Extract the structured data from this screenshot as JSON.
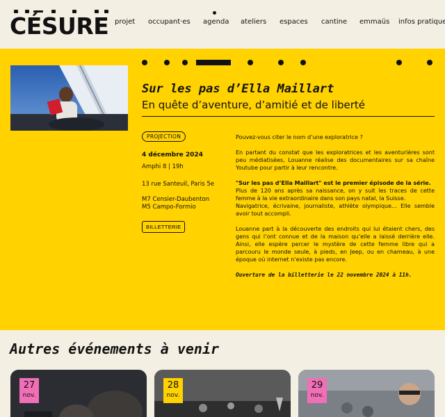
{
  "logo": {
    "text": "CÉSURE"
  },
  "nav": [
    {
      "id": "projet",
      "label": "projet"
    },
    {
      "id": "occupantes",
      "label": "occupant·es"
    },
    {
      "id": "agenda",
      "label": "agenda"
    },
    {
      "id": "ateliers",
      "label": "ateliers"
    },
    {
      "id": "espaces",
      "label": "espaces"
    },
    {
      "id": "cantine",
      "label": "cantine"
    },
    {
      "id": "emmaus",
      "label": "emmaüs"
    },
    {
      "id": "infos",
      "label": "infos pratique"
    }
  ],
  "event": {
    "title": "Sur les pas d’Ella Maillart",
    "subtitle": "En quête d’aventure, d’amitié et de liberté",
    "category": "PROJECTION",
    "date": "4 décembre 2024",
    "time": "Amphi 8 | 19h",
    "address": "13 rue Santeuil, Paris 5e",
    "metro1": "M7 Censier-Daubenton",
    "metro2": "M5 Campo-Formio",
    "ticket_button": "BILLETTERIE",
    "p1": "Pouvez-vous citer le nom d’une exploratrice ?",
    "p2": "En partant du constat que les exploratrices et les aventurières sont peu médiatisées, Louanne réalise des documentaires sur sa chaîne Youtube pour partir à leur rencontre.",
    "p3_bold": "\"Sur les pas d’Ella Maillart\" est le premier épisode de la série.",
    "p3_rest": "Plus de 120 ans après sa naissance, on y suit les traces de cette femme à la vie extraordinaire dans son pays natal, la Suisse.",
    "p4": "Navigatrice, écrivaine, journaliste, athlète olympique... Elle semble avoir tout accompli.",
    "p5": "Louanne part à la découverte des endroits qui lui étaient chers, des gens qui l’ont connue et de la maison qu’elle a laissé derrière elle. Ainsi, elle espère percer le mystère de cette femme libre qui a parcouru le monde seule, à pieds, en Jeep, ou en chameau, à une époque où internet n’existe pas encore.",
    "closing": "Ouverture de la billetterie le 22 novembre 2024 à 11h."
  },
  "upcoming": {
    "heading": "Autres événements à venir",
    "cards": [
      {
        "day": "27",
        "month": "nov."
      },
      {
        "day": "28",
        "month": "nov."
      },
      {
        "day": "29",
        "month": "nov."
      }
    ]
  },
  "colors": {
    "yellow": "#ffd200",
    "cream": "#f4efe3",
    "pink": "#f06fb6",
    "ink": "#111111"
  }
}
